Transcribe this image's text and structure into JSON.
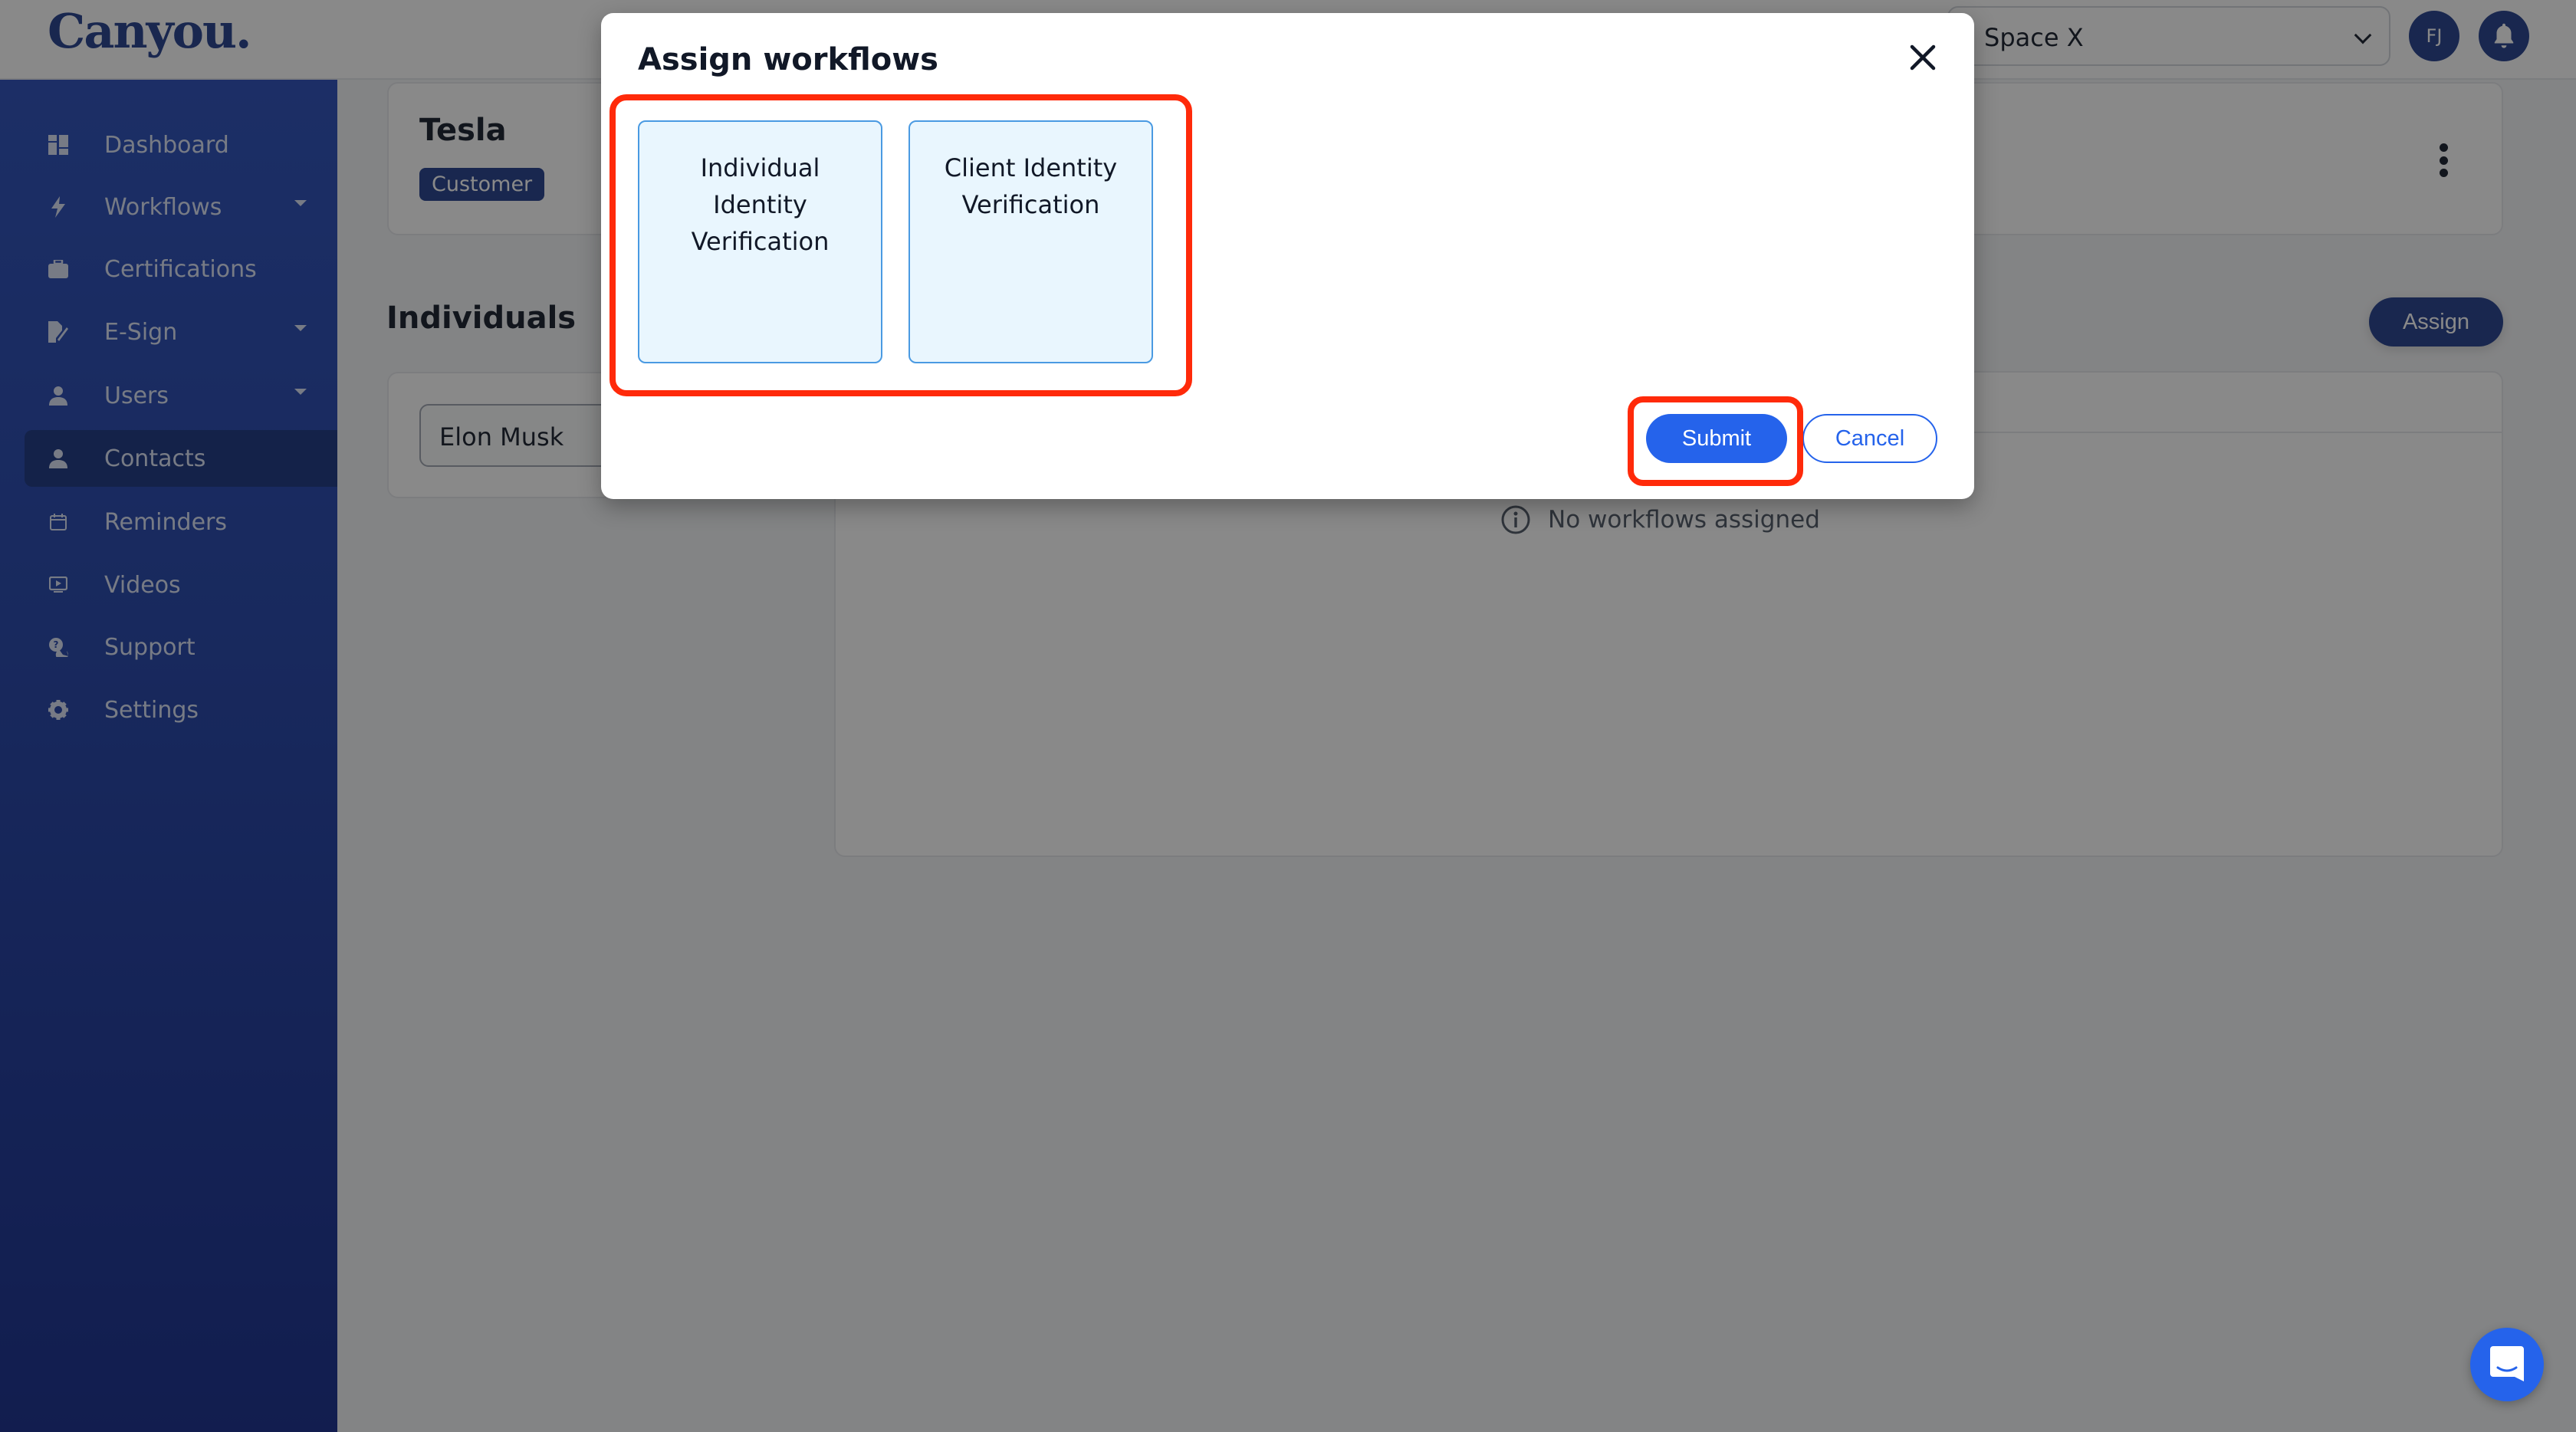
{
  "header": {
    "logo": "Canyou.",
    "space_selector": {
      "selected": "Space X"
    },
    "avatar_initials": "FJ",
    "notifications_icon": "bell-icon"
  },
  "sidebar": {
    "items": [
      {
        "label": "Dashboard",
        "icon": "dashboard-icon",
        "has_caret": false,
        "active": false
      },
      {
        "label": "Workflows",
        "icon": "lightning-icon",
        "has_caret": true,
        "active": false
      },
      {
        "label": "Certifications",
        "icon": "briefcase-icon",
        "has_caret": false,
        "active": false
      },
      {
        "label": "E-Sign",
        "icon": "signature-icon",
        "has_caret": true,
        "active": false
      },
      {
        "label": "Users",
        "icon": "user-icon",
        "has_caret": true,
        "active": false
      },
      {
        "label": "Contacts",
        "icon": "user-icon",
        "has_caret": false,
        "active": true
      },
      {
        "label": "Reminders",
        "icon": "calendar-icon",
        "has_caret": false,
        "active": false
      },
      {
        "label": "Videos",
        "icon": "video-icon",
        "has_caret": false,
        "active": false
      },
      {
        "label": "Support",
        "icon": "support-icon",
        "has_caret": false,
        "active": false
      },
      {
        "label": "Settings",
        "icon": "gear-icon",
        "has_caret": false,
        "active": false
      }
    ]
  },
  "main": {
    "contact": {
      "name": "Tesla",
      "badge": "Customer"
    },
    "individuals": {
      "title": "Individuals",
      "assign_label": "Assign",
      "people": [
        "Elon Musk"
      ]
    },
    "workflows_panel": {
      "empty_message": "No workflows assigned"
    }
  },
  "modal": {
    "title": "Assign workflows",
    "options": [
      {
        "label": "Individual Identity Verification"
      },
      {
        "label": "Client Identity Verification"
      }
    ],
    "submit_label": "Submit",
    "cancel_label": "Cancel"
  },
  "colors": {
    "brand": "#1e3a8a",
    "primary": "#2563eb",
    "option_bg": "#e9f6fe",
    "option_border": "#4a9ae2",
    "highlight": "#ff2a0a"
  }
}
